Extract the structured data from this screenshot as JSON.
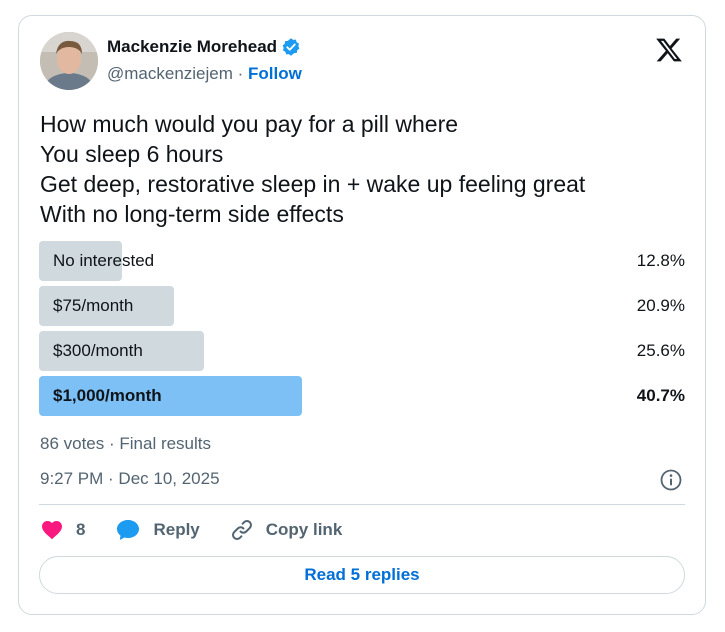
{
  "author": {
    "name": "Mackenzie Morehead",
    "handle": "@mackenziejem",
    "separator": " · ",
    "follow_label": "Follow",
    "verified": true
  },
  "tweet": {
    "lines": [
      "How much would you pay for a pill where",
      "You sleep 6 hours",
      "Get deep, restorative sleep in + wake up feeling great",
      "With no long-term side effects"
    ]
  },
  "poll": {
    "options": [
      {
        "label": "No interested",
        "percent_text": "12.8%",
        "percent": 12.8,
        "winner": false
      },
      {
        "label": "$75/month",
        "percent_text": "20.9%",
        "percent": 20.9,
        "winner": false
      },
      {
        "label": "$300/month",
        "percent_text": "25.6%",
        "percent": 25.6,
        "winner": false
      },
      {
        "label": "$1,000/month",
        "percent_text": "40.7%",
        "percent": 40.7,
        "winner": true
      }
    ],
    "summary": "86 votes · Final results"
  },
  "timestamp": "9:27 PM · Dec 10, 2025",
  "actions": {
    "like_count": "8",
    "reply_label": "Reply",
    "copy_link_label": "Copy link"
  },
  "read_replies_label": "Read 5 replies",
  "colors": {
    "accent": "#1d9bf0",
    "link": "#006fd6",
    "poll_bar": "#cfd9de",
    "poll_winner": "#7cc0f6",
    "heart": "#f91880"
  }
}
